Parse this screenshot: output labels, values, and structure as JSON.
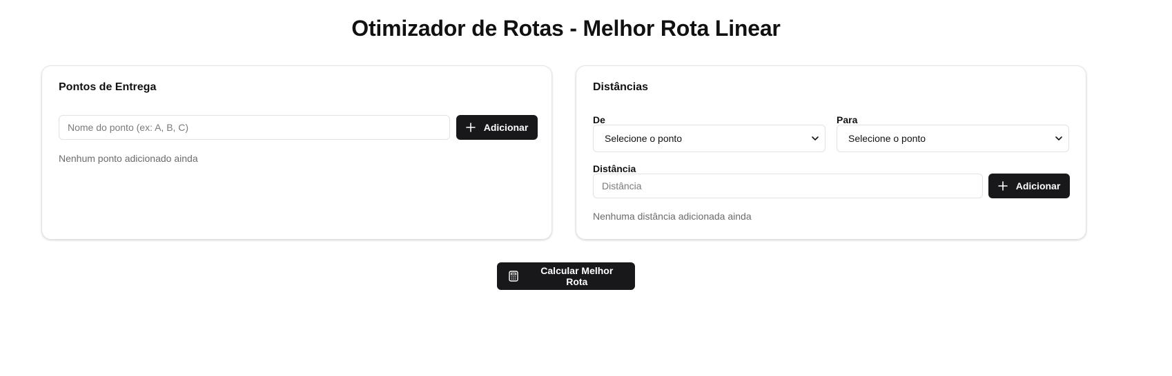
{
  "title": "Otimizador de Rotas - Melhor Rota Linear",
  "points_card": {
    "title": "Pontos de Entrega",
    "input_placeholder": "Nome do ponto (ex: A, B, C)",
    "add_label": "Adicionar",
    "empty_text": "Nenhum ponto adicionado ainda"
  },
  "distances_card": {
    "title": "Distâncias",
    "from_label": "De",
    "to_label": "Para",
    "from_value": "Selecione o ponto",
    "to_value": "Selecione o ponto",
    "distance_label": "Distância",
    "distance_placeholder": "Distância",
    "add_label": "Adicionar",
    "empty_text": "Nenhuma distância adicionada ainda"
  },
  "calculate_button": {
    "label": "Calcular Melhor Rota",
    "icon": "calculator-icon"
  },
  "colors": {
    "button_bg": "#18181b",
    "border": "#e2e2e2",
    "muted_text": "#6b6b6b"
  }
}
